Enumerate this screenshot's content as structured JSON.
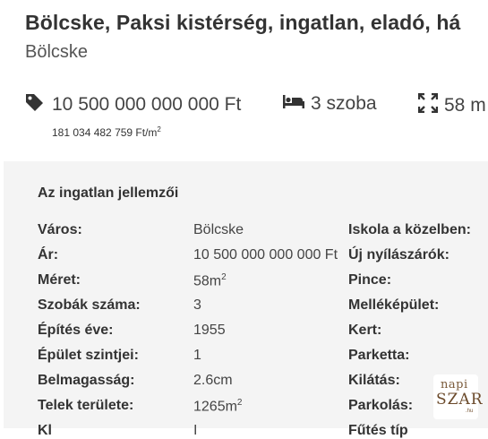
{
  "header": {
    "title": "Bölcske, Paksi kistérség, ingatlan, eladó, há",
    "location": "Bölcske"
  },
  "stats": {
    "price": "10 500 000 000 000 Ft",
    "rooms": "3 szoba",
    "size": "58 m",
    "price_per_sqm": "181 034 482 759 Ft/m",
    "price_per_sqm_exp": "2"
  },
  "icons": {
    "price": "price-tag-icon",
    "rooms": "bed-icon",
    "size": "expand-icon"
  },
  "details": {
    "title": "Az ingatlan jellemzői",
    "rows": [
      {
        "label": "Város:",
        "value": "Bölcske"
      },
      {
        "label": "Ár:",
        "value": "10 500 000 000 000 Ft"
      },
      {
        "label": "Méret:",
        "value": "58m",
        "sup": "2"
      },
      {
        "label": "Szobák száma:",
        "value": "3"
      },
      {
        "label": "Építés éve:",
        "value": "1955"
      },
      {
        "label": "Épület szintjei:",
        "value": "1"
      },
      {
        "label": "Belmagasság:",
        "value": "2.6cm"
      },
      {
        "label": "Telek területe:",
        "value": "1265m",
        "sup": "2"
      },
      {
        "label": "Kl",
        "value": "I"
      }
    ],
    "right_labels": [
      "Iskola a közelben:",
      "Új nyílászárók:",
      "Pince:",
      "Melléképület:",
      "Kert:",
      "Parketta:",
      "Kilátás:",
      "Parkolás:",
      "Fűtés típ"
    ]
  },
  "logo": {
    "line1": "napi",
    "line2": "SZAR",
    "line3": ".hu"
  }
}
